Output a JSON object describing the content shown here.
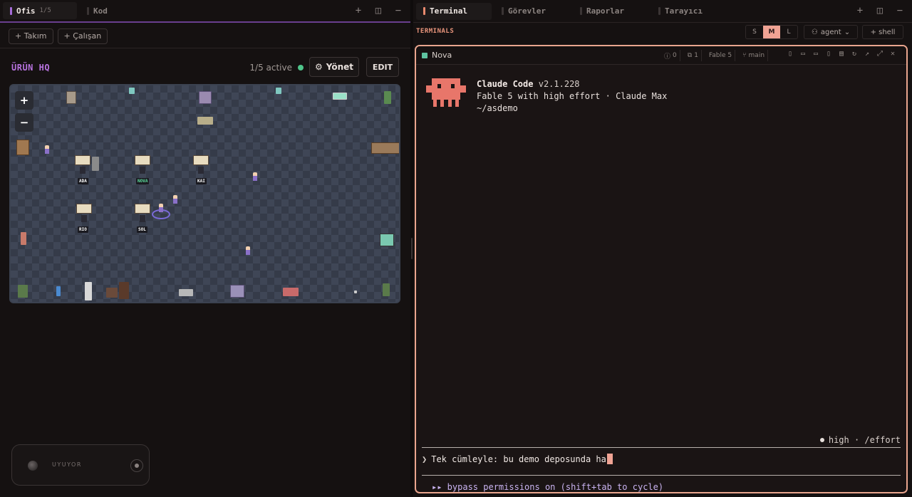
{
  "left": {
    "tabs": [
      {
        "label": "Ofis",
        "count": "1/5"
      },
      {
        "label": "Kod"
      }
    ],
    "tab_icons": [
      "plus-icon",
      "split-icon",
      "minimize-icon"
    ],
    "actions": {
      "add_team": "+ Takım",
      "add_employee": "+ Çalışan"
    },
    "hq": {
      "title": "ÜRÜN HQ",
      "active_text": "1/5 active",
      "manage_label": "Yönet",
      "edit_label": "EDIT"
    },
    "map": {
      "zoom_in": "+",
      "zoom_out": "−",
      "agents": [
        "ADA",
        "NOVA",
        "KAI",
        "RIO",
        "SOL"
      ]
    },
    "sleep": {
      "label": "UYUYOR"
    }
  },
  "right": {
    "tabs": [
      {
        "label": "Terminal"
      },
      {
        "label": "Görevler"
      },
      {
        "label": "Raporlar"
      },
      {
        "label": "Tarayıcı"
      }
    ],
    "terminals_label": "TERMINALS",
    "sizes": [
      "S",
      "M",
      "L"
    ],
    "selected_size": "M",
    "agent_label": "agent",
    "shell_label": "+ shell",
    "terminal": {
      "name": "Nova",
      "errors": "0",
      "copies": "1",
      "model": "Fable 5",
      "branch": "main",
      "claude_title": "Claude Code",
      "claude_version": "v2.1.228",
      "model_line": "Fable 5 with high effort · Claude Max",
      "path": "~/asdemo",
      "effort": "high · /effort",
      "prompt_text": "Tek cümleyle: bu demo deposunda ha",
      "bypass": "▸▸ bypass permissions on (shift+tab to cycle)"
    }
  },
  "colors": {
    "accent_purple": "#a56cd8",
    "accent_coral": "#e98a6e",
    "active_green": "#4fc48a",
    "terminal_border": "#e9a58e"
  }
}
